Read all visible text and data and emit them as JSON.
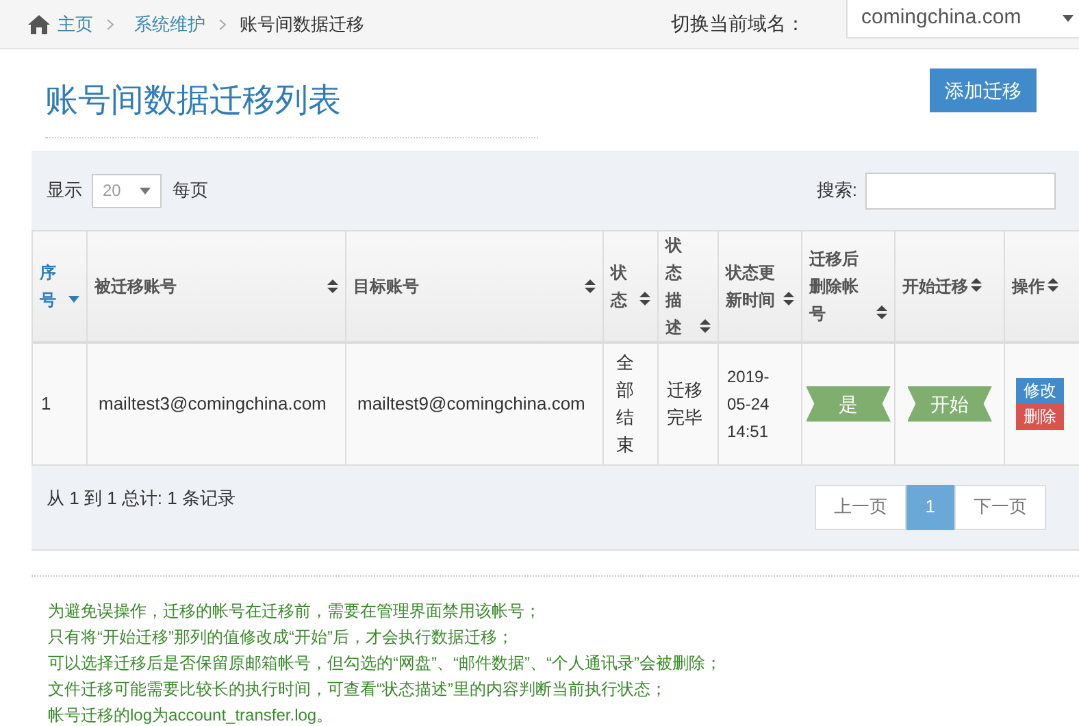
{
  "breadcrumb": [
    {
      "label": "主页",
      "link": true
    },
    {
      "label": "系统维护",
      "link": true
    },
    {
      "label": "账号间数据迁移",
      "link": false
    }
  ],
  "domain": {
    "label": "切换当前域名：",
    "value": "comingchina.com"
  },
  "title": "账号间数据迁移列表",
  "add_button": "添加迁移",
  "length": {
    "before": "显示",
    "value": "20",
    "after": "每页"
  },
  "search": {
    "label": "搜索:"
  },
  "table": {
    "columns": [
      {
        "label": "序号",
        "sorted": true
      },
      {
        "label": "被迁移账号",
        "sorted": false
      },
      {
        "label": "目标账号",
        "sorted": false
      },
      {
        "label": "状态",
        "sorted": false
      },
      {
        "label": "状态描述",
        "sorted": false
      },
      {
        "label": "状态更新时间",
        "sorted": false
      },
      {
        "label": "迁移后删除帐号",
        "sorted": false
      },
      {
        "label": "开始迁移",
        "sorted": false
      },
      {
        "label": "操作",
        "sorted": false
      }
    ],
    "rows": [
      {
        "index": "1",
        "source": "mailtest3@comingchina.com",
        "target": "mailtest9@comingchina.com",
        "status": "全部结束",
        "status_desc": "迁移完毕",
        "updated": "2019-05-24 14:51",
        "delete_after": "是",
        "start": "开始",
        "actions": [
          {
            "label": "修改",
            "kind": "edit"
          },
          {
            "label": "删除",
            "kind": "delete"
          }
        ]
      }
    ]
  },
  "info": "从 1 到 1 总计: 1 条记录",
  "pagination": [
    {
      "label": "上一页",
      "selected": false
    },
    {
      "label": "1",
      "selected": true
    },
    {
      "label": "下一页",
      "selected": false
    }
  ],
  "notes": [
    "为避免误操作，迁移的帐号在迁移前，需要在管理界面禁用该帐号；",
    "只有将“开始迁移”那列的值修改成“开始”后，才会执行数据迁移；",
    "可以选择迁移后是否保留原邮箱帐号，但勾选的“网盘”、“邮件数据”、“个人通讯录”会被删除；",
    "文件迁移可能需要比较长的执行时间，可查看“状态描述”里的内容判断当前执行状态；",
    "帐号迁移的log为account_transfer.log。"
  ]
}
